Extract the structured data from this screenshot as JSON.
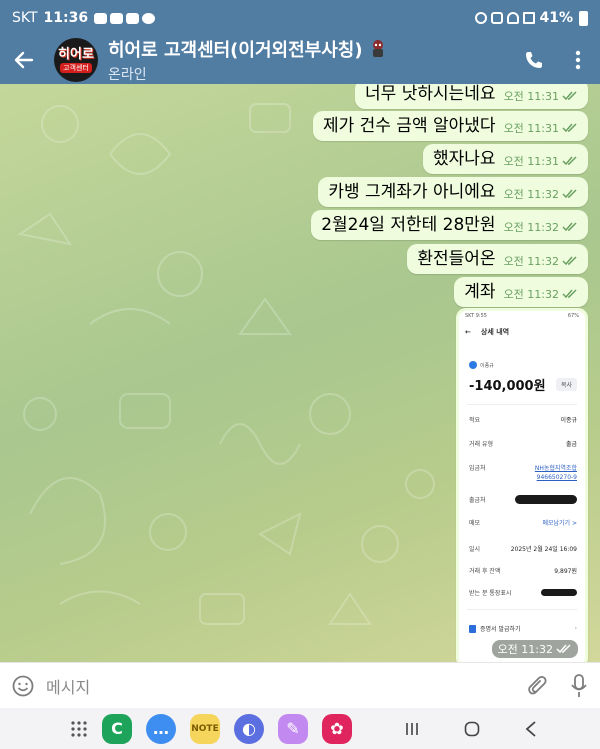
{
  "status_bar": {
    "carrier": "SKT",
    "time": "11:36",
    "battery": "41%"
  },
  "header": {
    "avatar_top": "히어로",
    "avatar_bottom": "고객센터",
    "title": "히어로 고객센터(이거외전부사칭)",
    "status": "온라인"
  },
  "messages": [
    {
      "text": "너무 낫하시는네요",
      "time": "오전 11:31"
    },
    {
      "text": "제가 건수 금액 알아냈다",
      "time": "오전 11:31"
    },
    {
      "text": "했자나요",
      "time": "오전 11:31"
    },
    {
      "text": "카뱅 그계좌가 아니에요",
      "time": "오전 11:32"
    },
    {
      "text": "2월24일 저한테 28만원",
      "time": "오전 11:32"
    },
    {
      "text": "환전들어온",
      "time": "오전 11:32"
    },
    {
      "text": "계좌",
      "time": "오전 11:32"
    }
  ],
  "image_message": {
    "time": "오전 11:32",
    "screenshot": {
      "status_time": "SKT 9:55",
      "status_battery": "67%",
      "title": "상세 내역",
      "account_name": "이종규",
      "amount": "-140,000원",
      "copy_label": "복사",
      "rows": [
        {
          "label": "적요",
          "value": "이종규"
        },
        {
          "label": "거래 유형",
          "value": "출금"
        },
        {
          "label": "입금처",
          "value": "NH농협지역조합"
        },
        {
          "label": "",
          "value": "946650270-9"
        },
        {
          "label": "출금처",
          "value": ""
        },
        {
          "label": "메모",
          "value": "메모남기기 >"
        },
        {
          "label": "일시",
          "value": "2025년 2월 24일 16:09"
        },
        {
          "label": "거래 후 잔액",
          "value": "9,897원"
        },
        {
          "label": "받는 분 통장표시",
          "value": ""
        }
      ],
      "certificate": "증명서 발급하기"
    }
  },
  "input": {
    "placeholder": "메시지"
  },
  "colors": {
    "header": "#527da3",
    "bubble": "#effdde",
    "check": "#6aa062"
  }
}
